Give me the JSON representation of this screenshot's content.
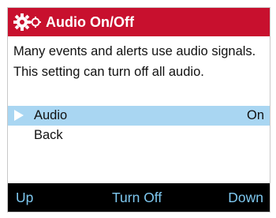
{
  "header": {
    "icon": "settings-gears-icon",
    "title": "Audio On/Off"
  },
  "description": "Many events and alerts use audio signals. This setting can turn off all audio.",
  "menu": {
    "items": [
      {
        "label": "Audio",
        "value": "On",
        "selected": true
      },
      {
        "label": "Back",
        "value": "",
        "selected": false
      }
    ]
  },
  "softkeys": {
    "left": "Up",
    "center": "Turn Off",
    "right": "Down"
  },
  "colors": {
    "title_bar": "#c8102e",
    "selected_row": "#a9d6f2",
    "softkey_text": "#7ec8f0",
    "softkey_bar": "#000000"
  }
}
